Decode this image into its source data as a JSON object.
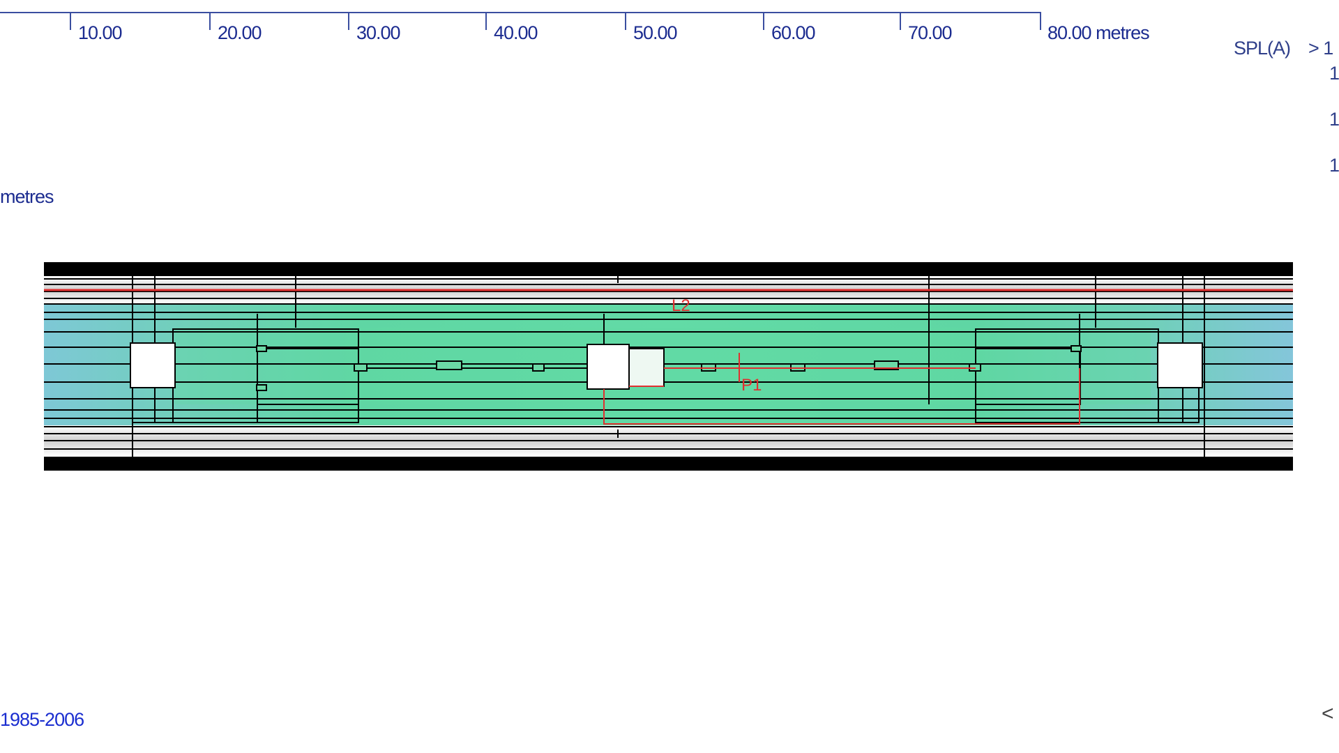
{
  "ruler": {
    "ticks": [
      "10.00",
      "20.00",
      "30.00",
      "40.00",
      "50.00",
      "60.00",
      "70.00",
      "80.00 metres"
    ]
  },
  "side_label": "metres",
  "copyright": "1985-2006",
  "legend": {
    "title": "SPL(A)",
    "values": [
      "> 1",
      "1",
      "1",
      "1"
    ]
  },
  "plan": {
    "line_label": "L2",
    "point_label": "P1"
  },
  "nav_arrow": "<",
  "colors": {
    "ruler": "#3a4ea0",
    "label": "#1c2c90",
    "copyright": "#1b2ed0",
    "field_green": "#5fd8a0",
    "field_teal": "#7ec8d6",
    "annotation_red": "#e03030",
    "wall_black": "#000000"
  }
}
